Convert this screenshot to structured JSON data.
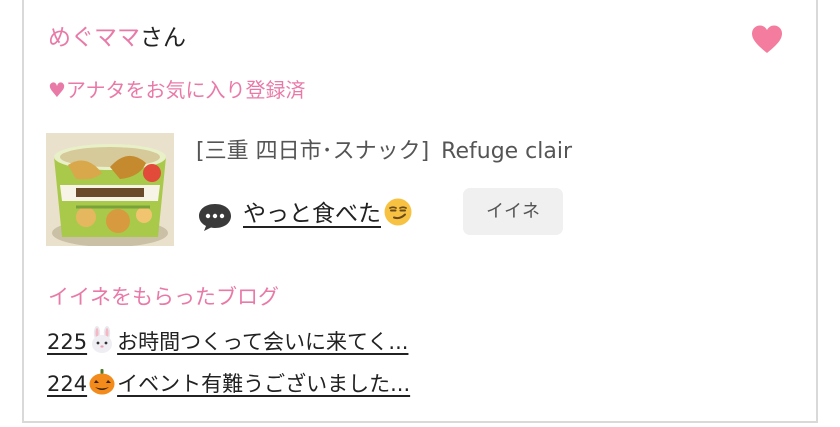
{
  "user": {
    "name": "めぐママ",
    "suffix": "さん",
    "favorite_status": "♥アナタをお気に入り登録済"
  },
  "post": {
    "shop_region": "[三重 四日市･スナック]",
    "shop_name": "Refuge clair",
    "title": "やっと食べた",
    "title_emoji": "smirking-face-emoji",
    "like_button_label": "イイネ",
    "thumbnail": "instant-noodle-cup-photo"
  },
  "liked_blogs": {
    "heading": "イイネをもらったブログ",
    "items": [
      {
        "number": "225",
        "emoji": "rabbit-face-emoji",
        "title": "お時間つくって会いに来てく..."
      },
      {
        "number": "224",
        "emoji": "jack-o-lantern-emoji",
        "title": "イベント有難うございました..."
      }
    ]
  },
  "icons": {
    "favorite": "heart-icon",
    "comment": "speech-bubble-icon"
  },
  "colors": {
    "accent_pink": "#e97aa8",
    "heart_pink": "#f47c9e",
    "button_bg": "#f0f0f0",
    "text_main": "#222222",
    "text_muted": "#555555",
    "border": "#d9d9d9"
  }
}
